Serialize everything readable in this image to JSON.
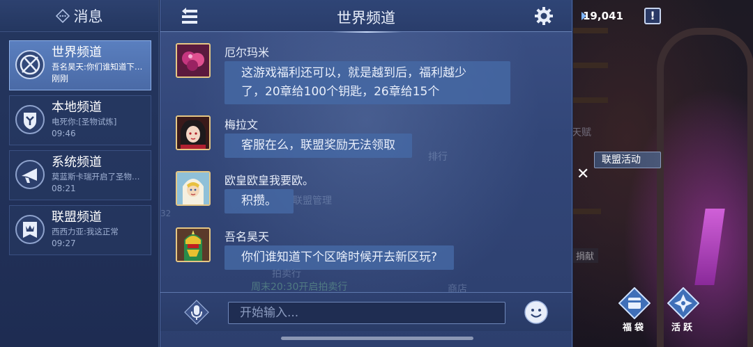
{
  "left_panel": {
    "title": "消息",
    "channels": [
      {
        "name": "世界频道",
        "last_message": "吾名昊天:你们谁知道下个...",
        "time": "刚刚",
        "icon": "world-icon"
      },
      {
        "name": "本地频道",
        "last_message": "电死你:[圣物试炼]",
        "time": "09:46",
        "icon": "local-shield-icon"
      },
      {
        "name": "系统频道",
        "last_message": "莫蓝斯卡瑞开启了圣物试...",
        "time": "08:21",
        "icon": "system-horn-icon"
      },
      {
        "name": "联盟频道",
        "last_message": "西西力亚:我这正常",
        "time": "09:27",
        "icon": "alliance-banner-icon"
      }
    ]
  },
  "chat": {
    "title": "世界频道",
    "messages": [
      {
        "sender": "厄尔玛米",
        "lines": [
          "这游戏福利还可以，就是越到后，福利越少",
          "了，20章给100个钥匙，26章给15个"
        ]
      },
      {
        "sender": "梅拉文",
        "lines": [
          "客服在么，联盟奖励无法领取"
        ]
      },
      {
        "sender": "欧皇欧皇我要欧。",
        "lines": [
          "积攒。"
        ]
      },
      {
        "sender": "吾名昊天",
        "lines": [
          "你们谁知道下个区啥时候开去新区玩?"
        ]
      }
    ],
    "input_placeholder": "开始输入...",
    "background_texts": [
      "排行",
      "联盟管理",
      "拍卖行",
      "周末20:30开启拍卖行",
      "商店",
      "32"
    ]
  },
  "game_area": {
    "resource_value": "19,041",
    "alert_label": "!",
    "alliance_activity_label": "联盟活动",
    "close_label": "✕",
    "side_texts": [
      "天赋",
      "捐献"
    ],
    "buttons": [
      {
        "label": "福袋",
        "icon": "lucky-bag-icon"
      },
      {
        "label": "活跃",
        "icon": "activity-icon"
      }
    ]
  },
  "colors": {
    "active_channel": "#5a7fbf",
    "bubble": "#4669a5",
    "avatar_border": "#e6c784",
    "panel": "#324678"
  }
}
